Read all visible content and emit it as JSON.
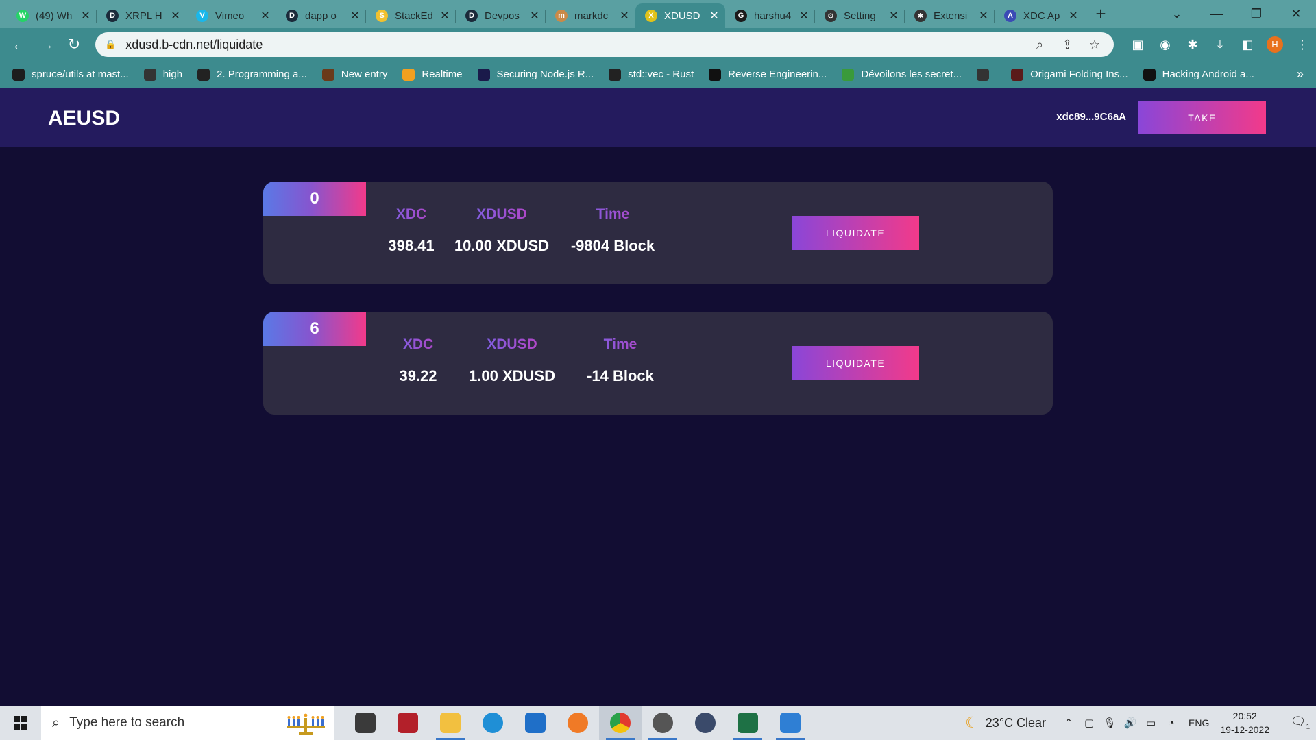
{
  "browser": {
    "tabs": [
      {
        "title": "(49) Wh",
        "color": "#25d366",
        "glyph": "W"
      },
      {
        "title": "XRPL H",
        "color": "#1b2a3a",
        "glyph": "D"
      },
      {
        "title": "Vimeo",
        "color": "#1ab7ea",
        "glyph": "V"
      },
      {
        "title": "dapp o",
        "color": "#1b2a3a",
        "glyph": "D"
      },
      {
        "title": "StackEd",
        "color": "#f2c12e",
        "glyph": "S"
      },
      {
        "title": "Devpos",
        "color": "#1b2a3a",
        "glyph": "D"
      },
      {
        "title": "markdc",
        "color": "#c98a48",
        "glyph": "m"
      },
      {
        "title": "XDUSD",
        "color": "#e0c21a",
        "glyph": "X"
      },
      {
        "title": "harshu4",
        "color": "#1b1b1b",
        "glyph": "G"
      },
      {
        "title": "Setting",
        "color": "#333333",
        "glyph": "⚙"
      },
      {
        "title": "Extensi",
        "color": "#333333",
        "glyph": "✱"
      },
      {
        "title": "XDC Ap",
        "color": "#3b4bb5",
        "glyph": "A"
      }
    ],
    "active_tab_index": 7,
    "new_tab_label": "+",
    "url": "xdusd.b-cdn.net/liquidate",
    "profile_initial": "H",
    "bookmarks": [
      "spruce/utils at mast...",
      "high",
      "2. Programming a...",
      "New entry",
      "Realtime",
      "Securing Node.js R...",
      "std::vec - Rust",
      "Reverse Engineerin...",
      "Dévoilons les secret...",
      "",
      "Origami Folding Ins...",
      "Hacking Android a..."
    ],
    "bookmarks_more": "»"
  },
  "app": {
    "brand": "AEUSD",
    "wallet": "xdc89...9C6aA",
    "take_label": "TAKE",
    "positions": [
      {
        "index": "0",
        "xdc_label": "XDC",
        "xdc_value": "398.41",
        "xdusd_label": "XDUSD",
        "xdusd_value": "10.00 XDUSD",
        "time_label": "Time",
        "time_value": "-9804 Block",
        "button": "LIQUIDATE"
      },
      {
        "index": "6",
        "xdc_label": "XDC",
        "xdc_value": "39.22",
        "xdusd_label": "XDUSD",
        "xdusd_value": "1.00 XDUSD",
        "time_label": "Time",
        "time_value": "-14 Block",
        "button": "LIQUIDATE"
      }
    ],
    "colors": {
      "background": "#120d33",
      "header": "#241b5e",
      "card": "#2e2b41",
      "accent_start": "#8a46d8",
      "accent_end": "#f23a8a"
    }
  },
  "taskbar": {
    "search_placeholder": "Type here to search",
    "weather": "23°C  Clear",
    "language": "ENG",
    "time": "20:52",
    "date": "19-12-2022",
    "notification_count": "1"
  }
}
